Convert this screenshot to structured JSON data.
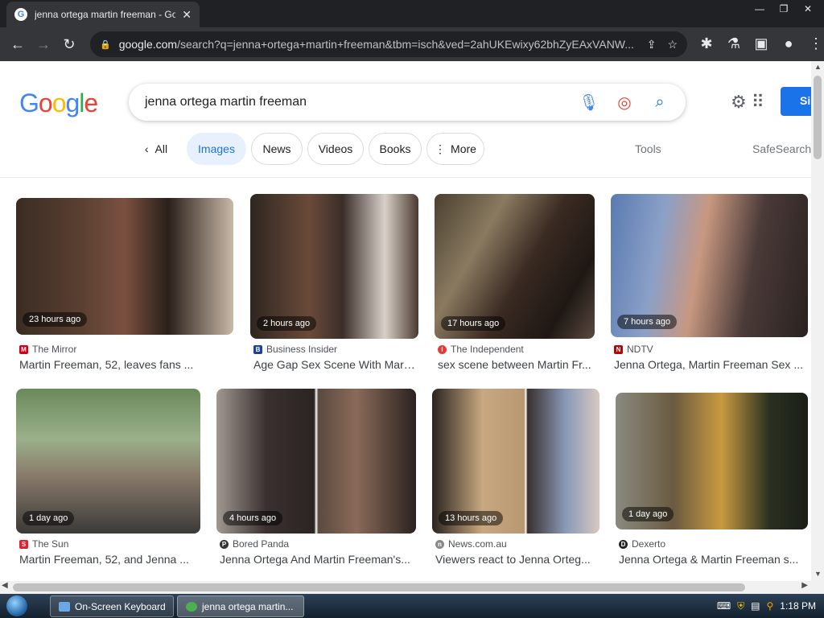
{
  "browser": {
    "tab_title": "jenna ortega martin freeman - Go",
    "tab_close": "✕",
    "url_domain": "google.com",
    "url_path": "/search?q=jenna+ortega+martin+freeman&tbm=isch&ved=2ahUKEwixy62bhZyEAxVANW...",
    "window_controls": [
      "—",
      "❐",
      "✕"
    ]
  },
  "google": {
    "logo": "Google",
    "query": "jenna ortega martin freeman",
    "signin_label": "Si",
    "tabs": [
      {
        "label": "All",
        "icon": "chevron-left"
      },
      {
        "label": "Images",
        "active": true
      },
      {
        "label": "News"
      },
      {
        "label": "Videos"
      },
      {
        "label": "Books"
      },
      {
        "label": "More",
        "icon": "vertical-dots"
      }
    ],
    "tools_label": "Tools",
    "safesearch_label": "SafeSearch"
  },
  "results": [
    {
      "time": "23 hours ago",
      "source": "The Mirror",
      "title": "Martin Freeman, 52, leaves fans ...",
      "color": "#d0021b",
      "letter": "M"
    },
    {
      "time": "2 hours ago",
      "source": "Business Insider",
      "title": "Age Gap Sex Scene With Marti...",
      "color": "#1a3fa6",
      "letter": "B"
    },
    {
      "time": "17 hours ago",
      "source": "The Independent",
      "title": "sex scene between Martin Fr...",
      "color": "#e03a3a",
      "letter": "I"
    },
    {
      "time": "7 hours ago",
      "source": "NDTV",
      "title": "Jenna Ortega, Martin Freeman Sex ...",
      "color": "#c00000",
      "letter": "N"
    },
    {
      "time": "1 day ago",
      "source": "The Sun",
      "title": "Martin Freeman, 52, and Jenna ...",
      "color": "#e5202e",
      "letter": "S"
    },
    {
      "time": "4 hours ago",
      "source": "Bored Panda",
      "title": "Jenna Ortega And Martin Freeman's...",
      "color": "#333333",
      "letter": "P"
    },
    {
      "time": "13 hours ago",
      "source": "News.com.au",
      "title": "Viewers react to Jenna Orteg...",
      "color": "#888888",
      "letter": "n"
    },
    {
      "time": "1 day ago",
      "source": "Dexerto",
      "title": "Jenna Ortega & Martin Freeman s...",
      "color": "#222222",
      "letter": "D"
    }
  ],
  "taskbar": {
    "items": [
      "On-Screen Keyboard",
      "jenna ortega martin..."
    ],
    "clock": "1:18 PM"
  }
}
